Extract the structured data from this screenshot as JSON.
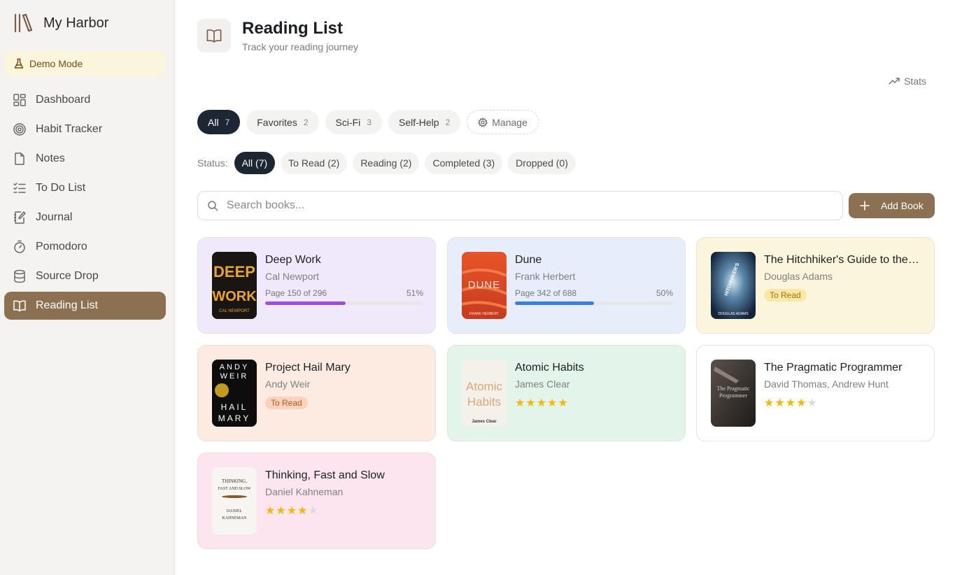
{
  "app": {
    "name": "My Harbor",
    "demo_label": "Demo Mode"
  },
  "sidebar": {
    "items": [
      {
        "label": "Dashboard",
        "icon": "dashboard-icon"
      },
      {
        "label": "Habit Tracker",
        "icon": "target-icon"
      },
      {
        "label": "Notes",
        "icon": "file-icon"
      },
      {
        "label": "To Do List",
        "icon": "checklist-icon"
      },
      {
        "label": "Journal",
        "icon": "notebook-pen-icon"
      },
      {
        "label": "Pomodoro",
        "icon": "timer-icon"
      },
      {
        "label": "Source Drop",
        "icon": "database-icon"
      },
      {
        "label": "Reading List",
        "icon": "book-open-icon",
        "active": true
      }
    ]
  },
  "header": {
    "title": "Reading List",
    "subtitle": "Track your reading journey",
    "stats_label": "Stats"
  },
  "filters": {
    "chips": [
      {
        "label": "All",
        "count": "7",
        "active": true
      },
      {
        "label": "Favorites",
        "count": "2"
      },
      {
        "label": "Sci-Fi",
        "count": "3"
      },
      {
        "label": "Self-Help",
        "count": "2"
      }
    ],
    "manage_label": "Manage"
  },
  "status": {
    "label": "Status:",
    "options": [
      "All (7)",
      "To Read (2)",
      "Reading (2)",
      "Completed (3)",
      "Dropped (0)"
    ],
    "selected": "All (7)"
  },
  "search": {
    "placeholder": "Search books..."
  },
  "add_button": {
    "label": "Add Book"
  },
  "books": [
    {
      "title": "Deep Work",
      "author": "Cal Newport",
      "status": "reading",
      "progress_text": "Page 150 of 296",
      "percent_text": "51%",
      "progress": 0.51,
      "bar_color": "#9b4fe0",
      "card_bg": "#f0e8fb",
      "cover_text": [
        "DEEP",
        "WORK",
        "CAL NEWPORT"
      ]
    },
    {
      "title": "Dune",
      "author": "Frank Herbert",
      "status": "reading",
      "progress_text": "Page 342 of 688",
      "percent_text": "50%",
      "progress": 0.5,
      "bar_color": "#3b7ddd",
      "card_bg": "#e6eefb",
      "cover_text": [
        "DUNE",
        "FRANK HERBERT"
      ]
    },
    {
      "title": "The Hitchhiker's Guide to the Galaxy",
      "author": "Douglas Adams",
      "status": "to-read",
      "badge": "To Read",
      "badge_bg": "#fce8a6",
      "badge_color": "#a0700a",
      "card_bg": "#fbf5dc",
      "cover_text": [
        "HITCHHIKER'S",
        "DOUGLAS ADAMS"
      ]
    },
    {
      "title": "Project Hail Mary",
      "author": "Andy Weir",
      "status": "to-read",
      "badge": "To Read",
      "badge_bg": "#fbd3bd",
      "badge_color": "#c2551d",
      "card_bg": "#fdebe1",
      "cover_text": [
        "ANDY",
        "WEIR",
        "HAIL",
        "MARY"
      ]
    },
    {
      "title": "Atomic Habits",
      "author": "James Clear",
      "status": "completed",
      "rating": 5,
      "card_bg": "#e3f5ea",
      "cover_text": [
        "Atomic",
        "Habits",
        "James Clear"
      ]
    },
    {
      "title": "The Pragmatic Programmer",
      "author": "David Thomas, Andrew Hunt",
      "status": "completed",
      "rating": 4,
      "card_bg": "#ffffff",
      "cover_text": [
        "The Pragmatic",
        "Programmer"
      ]
    },
    {
      "title": "Thinking, Fast and Slow",
      "author": "Daniel Kahneman",
      "status": "completed",
      "rating": 4,
      "card_bg": "#fce5ef",
      "cover_text": [
        "THINKING,",
        "FAST AND SLOW",
        "DANIEL",
        "KAHNEMAN"
      ]
    }
  ]
}
